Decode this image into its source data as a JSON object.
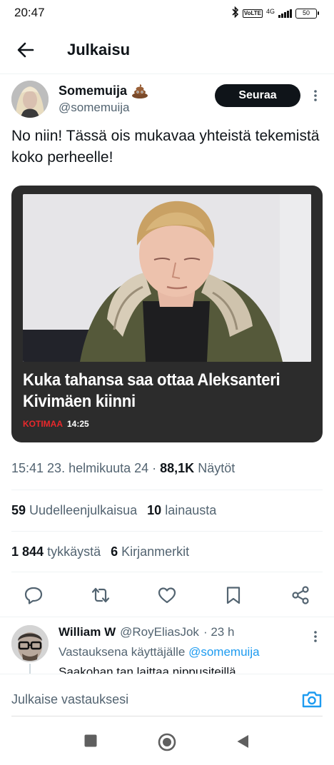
{
  "status_bar": {
    "time": "20:47",
    "network": "4G",
    "battery": "50"
  },
  "header": {
    "title": "Julkaisu"
  },
  "post": {
    "author_name": "Somemuija",
    "author_handle": "@somemuija",
    "follow_label": "Seuraa",
    "text": "No niin! Tässä ois mukavaa yhteistä tekemistä koko perheelle!",
    "card": {
      "headline": "Kuka tahansa saa ottaa Aleksanteri Kivimäen kiinni",
      "category": "KOTIMAA",
      "time": "14:25"
    },
    "meta": {
      "timestamp": "15:41 23. helmikuuta 24",
      "separator": " · ",
      "views_count": "88,1K",
      "views_label": "Näytöt"
    },
    "stats": {
      "reposts_count": "59",
      "reposts_label": "Uudelleenjulkaisua",
      "quotes_count": "10",
      "quotes_label": "lainausta",
      "likes_count": "1 844",
      "likes_label": "tykkäystä",
      "bookmarks_count": "6",
      "bookmarks_label": "Kirjanmerkit"
    }
  },
  "reply": {
    "author_name": "William W",
    "author_handle": "@RoyEliasJok",
    "time": "· 23 h",
    "reply_to_prefix": "Vastauksena käyttäjälle",
    "reply_to_handle": "@somemuija",
    "text_partial": "Saakohan tan laittaa nippusiteillä"
  },
  "compose": {
    "placeholder": "Julkaise vastauksesi"
  },
  "colors": {
    "text": "#0f1419",
    "secondary": "#536471",
    "accent": "#1d9bf0",
    "card_bg": "#2c2c2c",
    "category_red": "#e8282b"
  },
  "icons": {
    "back": "arrow-left-icon",
    "more": "more-vertical-icon",
    "reply": "reply-icon",
    "repost": "repost-icon",
    "like": "heart-icon",
    "bookmark": "bookmark-icon",
    "share": "share-icon",
    "camera": "camera-icon"
  }
}
